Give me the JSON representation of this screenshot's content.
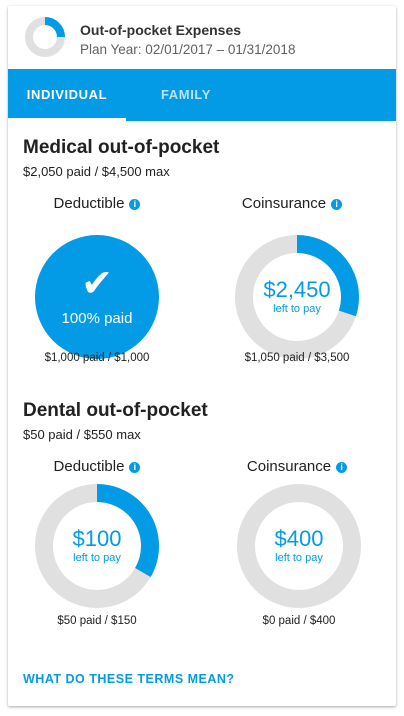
{
  "header": {
    "title": "Out-of-pocket Expenses",
    "plan_year": "Plan Year: 02/01/2017 – 01/31/2018",
    "progress_fraction": 0.25
  },
  "tabs": [
    {
      "label": "INDIVIDUAL",
      "selected": true
    },
    {
      "label": "FAMILY",
      "selected": false
    }
  ],
  "colors": {
    "accent": "#039be5",
    "track": "#e0e0e0"
  },
  "medical": {
    "title": "Medical out-of-pocket",
    "summary": "$2,050 paid / $4,500 max",
    "deductible": {
      "label": "Deductible",
      "status": "100% paid",
      "paid_fraction": 1.0,
      "detail": "$1,000 paid / $1,000"
    },
    "coinsurance": {
      "label": "Coinsurance",
      "amount": "$2,450",
      "caption": "left to pay",
      "paid_fraction": 0.3,
      "detail": "$1,050 paid / $3,500"
    }
  },
  "dental": {
    "title": "Dental out-of-pocket",
    "summary": "$50 paid / $550 max",
    "deductible": {
      "label": "Deductible",
      "amount": "$100",
      "caption": "left to pay",
      "paid_fraction": 0.333,
      "detail": "$50 paid / $150"
    },
    "coinsurance": {
      "label": "Coinsurance",
      "amount": "$400",
      "caption": "left to pay",
      "paid_fraction": 0.0,
      "detail": "$0 paid / $400"
    }
  },
  "footer": {
    "terms_link": "WHAT DO THESE TERMS MEAN?"
  },
  "icons": {
    "info": "info-icon",
    "check": "checkmark-icon"
  }
}
